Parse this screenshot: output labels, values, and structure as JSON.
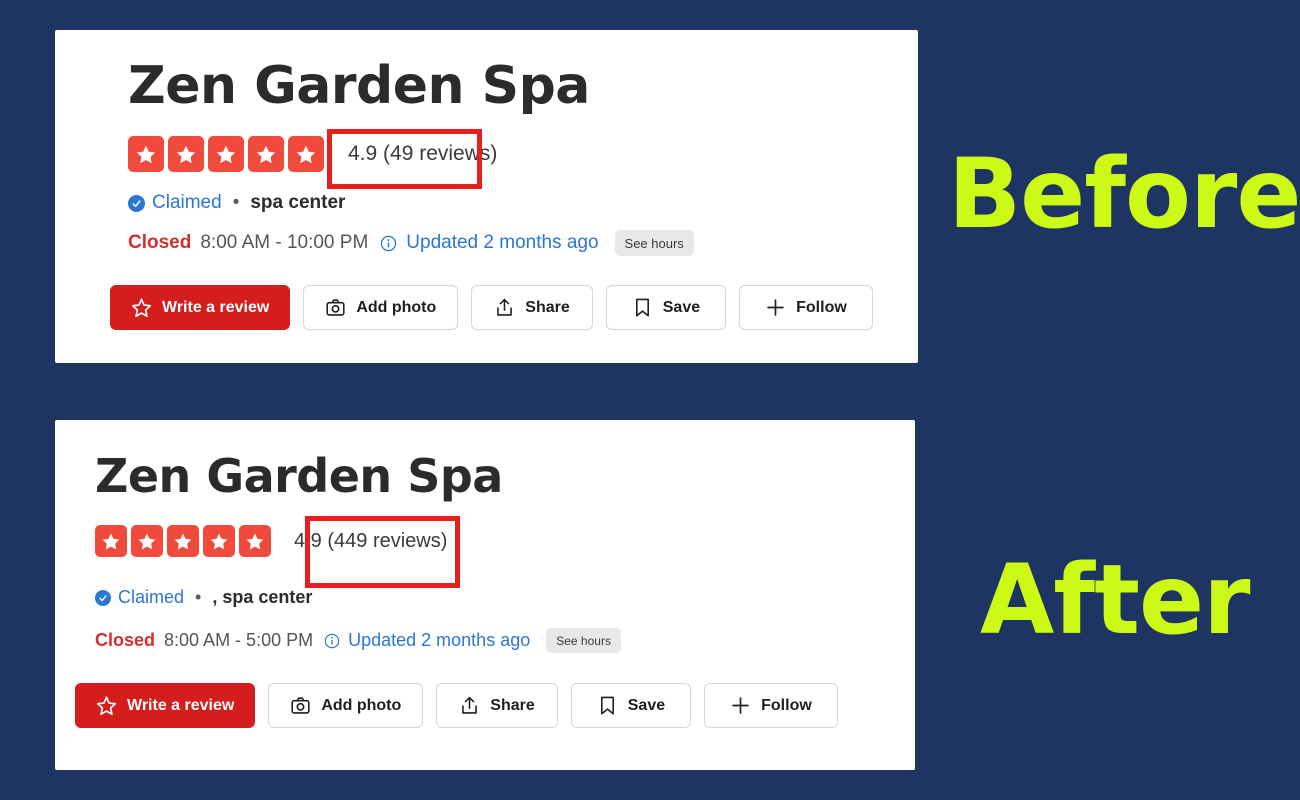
{
  "background_color": "#1e3462",
  "accent_colors": {
    "star": "#ef4a3c",
    "primary_button": "#d41e1e",
    "annotation_box": "#e81f1f",
    "link": "#2b76d2",
    "closed": "#d42f2f",
    "highlight_label": "#ccf916"
  },
  "comparison": {
    "before_label": "Before",
    "after_label": "After"
  },
  "before": {
    "title": "Zen Garden Spa",
    "rating": {
      "value": "4.9",
      "stars_filled": 5,
      "review_text": "4.9 (49 reviews)",
      "review_count": "49"
    },
    "claimed": {
      "badge_label": "Claimed",
      "separator": "•",
      "category": "spa center"
    },
    "hours": {
      "status": "Closed",
      "range": "8:00 AM - 10:00 PM",
      "updated": "Updated 2 months ago",
      "see_hours_label": "See hours"
    },
    "actions": [
      {
        "label": "Write a review",
        "icon": "star-outline-icon",
        "style": "primary"
      },
      {
        "label": "Add photo",
        "icon": "camera-icon",
        "style": "default"
      },
      {
        "label": "Share",
        "icon": "share-icon",
        "style": "default"
      },
      {
        "label": "Save",
        "icon": "bookmark-icon",
        "style": "default"
      },
      {
        "label": "Follow",
        "icon": "plus-icon",
        "style": "default"
      }
    ]
  },
  "after": {
    "title": "Zen Garden Spa",
    "rating": {
      "value": "4.9",
      "stars_filled": 5,
      "review_text": "4.9 (449 reviews)",
      "review_count": "449"
    },
    "claimed": {
      "badge_label": "Claimed",
      "separator": "•",
      "category": ", spa center"
    },
    "hours": {
      "status": "Closed",
      "range": "8:00 AM - 5:00 PM",
      "updated": "Updated 2 months ago",
      "see_hours_label": "See hours"
    },
    "actions": [
      {
        "label": "Write a review",
        "icon": "star-outline-icon",
        "style": "primary"
      },
      {
        "label": "Add photo",
        "icon": "camera-icon",
        "style": "default"
      },
      {
        "label": "Share",
        "icon": "share-icon",
        "style": "default"
      },
      {
        "label": "Save",
        "icon": "bookmark-icon",
        "style": "default"
      },
      {
        "label": "Follow",
        "icon": "plus-icon",
        "style": "default"
      }
    ]
  }
}
